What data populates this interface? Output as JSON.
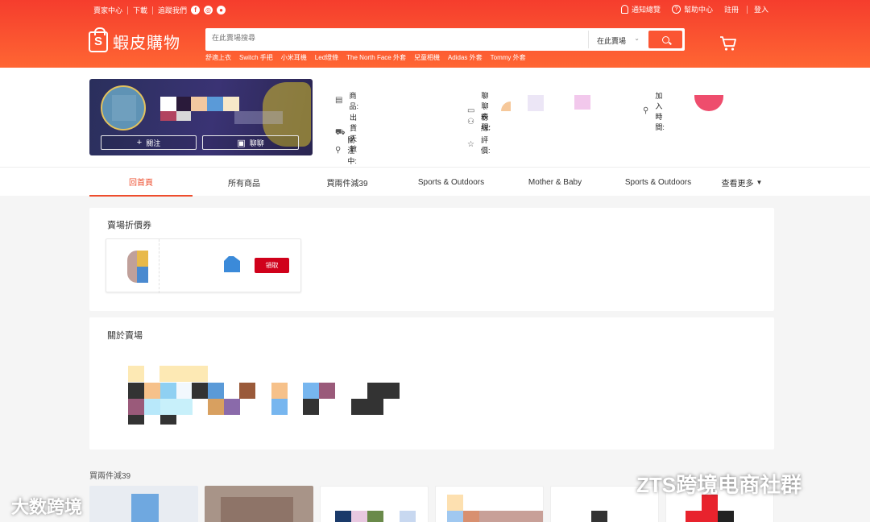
{
  "colors": {
    "brand": "#ee4d2d",
    "header_top": "#f53d2d",
    "header_bottom": "#ff6633",
    "claim_red": "#d0011b"
  },
  "topbar": {
    "seller_center": "賣家中心",
    "download": "下載",
    "follow_us": "追蹤我們",
    "notifications": "通知總覽",
    "help": "幫助中心",
    "register": "註冊",
    "login": "登入"
  },
  "header": {
    "logo_text": "蝦皮購物",
    "search_placeholder": "在此賣場搜尋",
    "search_scope": "在此賣場",
    "hot_keywords": [
      "舒適上衣",
      "Switch 手把",
      "小米耳機",
      "Led燈條",
      "The North Face 外套",
      "兒童相機",
      "Adidas 外套",
      "Tommy 外套"
    ]
  },
  "shop": {
    "follow_label": "關注",
    "chat_label": "聊聊",
    "stats": {
      "products": "商品:",
      "ship_days": "出貨天數",
      "following": "關注中:",
      "chat_perf": "聊聊表現:",
      "followers": "粉絲:",
      "rating": "評價:",
      "joined": "加入時間:"
    }
  },
  "nav": {
    "tabs": [
      "回首頁",
      "所有商品",
      "買兩件減39",
      "Sports & Outdoors",
      "Mother & Baby",
      "Sports & Outdoors"
    ],
    "more": "查看更多"
  },
  "vouchers": {
    "title": "賣場折價券",
    "claim_label": "領取"
  },
  "about": {
    "title": "關於賣場"
  },
  "promo_section": {
    "title": "買兩件減39"
  },
  "watermarks": {
    "left": "大数跨境",
    "right": "ZTS跨境电商社群"
  }
}
